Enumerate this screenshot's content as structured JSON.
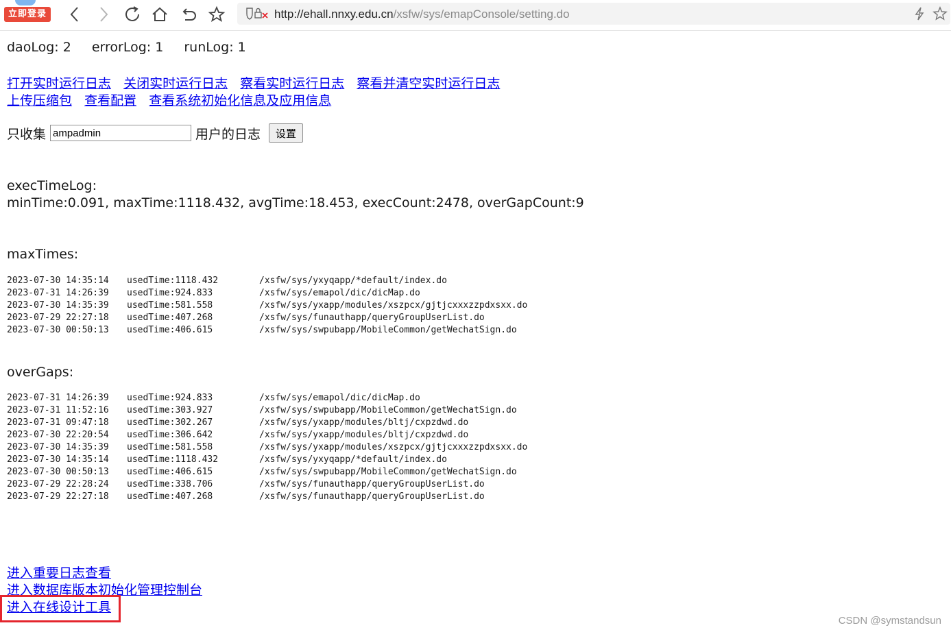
{
  "browser": {
    "login_badge": "立即登录",
    "url_host": "http://ehall.nnxy.edu.cn",
    "url_path": "/xsfw/sys/emapConsole/setting.do"
  },
  "counters": {
    "dao": "daoLog: 2",
    "error": "errorLog: 1",
    "run": "runLog: 1"
  },
  "actions": {
    "open_log": "打开实时运行日志",
    "close_log": "关闭实时运行日志",
    "view_log": "察看实时运行日志",
    "view_clear_log": "察看并清空实时运行日志",
    "upload_zip": "上传压缩包",
    "view_config": "查看配置",
    "view_init": "查看系统初始化信息及应用信息"
  },
  "collect": {
    "prefix": "只收集",
    "user_value": "ampadmin",
    "suffix": "用户的日志",
    "button": "设置"
  },
  "exec_time": {
    "label": "execTimeLog:",
    "summary": "minTime:0.091, maxTime:1118.432, avgTime:18.453, execCount:2478, overGapCount:9"
  },
  "max_times": {
    "label": "maxTimes:",
    "rows": [
      {
        "time": "2023-07-30 14:35:14",
        "used": "usedTime:1118.432",
        "path": "/xsfw/sys/yxyqapp/*default/index.do"
      },
      {
        "time": "2023-07-31 14:26:39",
        "used": "usedTime:924.833",
        "path": "/xsfw/sys/emapol/dic/dicMap.do"
      },
      {
        "time": "2023-07-30 14:35:39",
        "used": "usedTime:581.558",
        "path": "/xsfw/sys/yxapp/modules/xszpcx/gjtjcxxxzzpdxsxx.do"
      },
      {
        "time": "2023-07-29 22:27:18",
        "used": "usedTime:407.268",
        "path": "/xsfw/sys/funauthapp/queryGroupUserList.do"
      },
      {
        "time": "2023-07-30 00:50:13",
        "used": "usedTime:406.615",
        "path": "/xsfw/sys/swpubapp/MobileCommon/getWechatSign.do"
      }
    ]
  },
  "over_gaps": {
    "label": "overGaps:",
    "rows": [
      {
        "time": "2023-07-31 14:26:39",
        "used": "usedTime:924.833",
        "path": "/xsfw/sys/emapol/dic/dicMap.do"
      },
      {
        "time": "2023-07-31 11:52:16",
        "used": "usedTime:303.927",
        "path": "/xsfw/sys/swpubapp/MobileCommon/getWechatSign.do"
      },
      {
        "time": "2023-07-31 09:47:18",
        "used": "usedTime:302.267",
        "path": "/xsfw/sys/yxapp/modules/bltj/cxpzdwd.do"
      },
      {
        "time": "2023-07-30 22:20:54",
        "used": "usedTime:306.642",
        "path": "/xsfw/sys/yxapp/modules/bltj/cxpzdwd.do"
      },
      {
        "time": "2023-07-30 14:35:39",
        "used": "usedTime:581.558",
        "path": "/xsfw/sys/yxapp/modules/xszpcx/gjtjcxxxzzpdxsxx.do"
      },
      {
        "time": "2023-07-30 14:35:14",
        "used": "usedTime:1118.432",
        "path": "/xsfw/sys/yxyqapp/*default/index.do"
      },
      {
        "time": "2023-07-30 00:50:13",
        "used": "usedTime:406.615",
        "path": "/xsfw/sys/swpubapp/MobileCommon/getWechatSign.do"
      },
      {
        "time": "2023-07-29 22:28:24",
        "used": "usedTime:338.706",
        "path": "/xsfw/sys/funauthapp/queryGroupUserList.do"
      },
      {
        "time": "2023-07-29 22:27:18",
        "used": "usedTime:407.268",
        "path": "/xsfw/sys/funauthapp/queryGroupUserList.do"
      }
    ]
  },
  "bottom_links": {
    "important_logs": "进入重要日志查看",
    "db_console": "进入数据库版本初始化管理控制台",
    "design_tool": "进入在线设计工具"
  },
  "highlight_color": "#e4252d",
  "link_color": "#0000ee",
  "watermark": "CSDN @symstandsun"
}
